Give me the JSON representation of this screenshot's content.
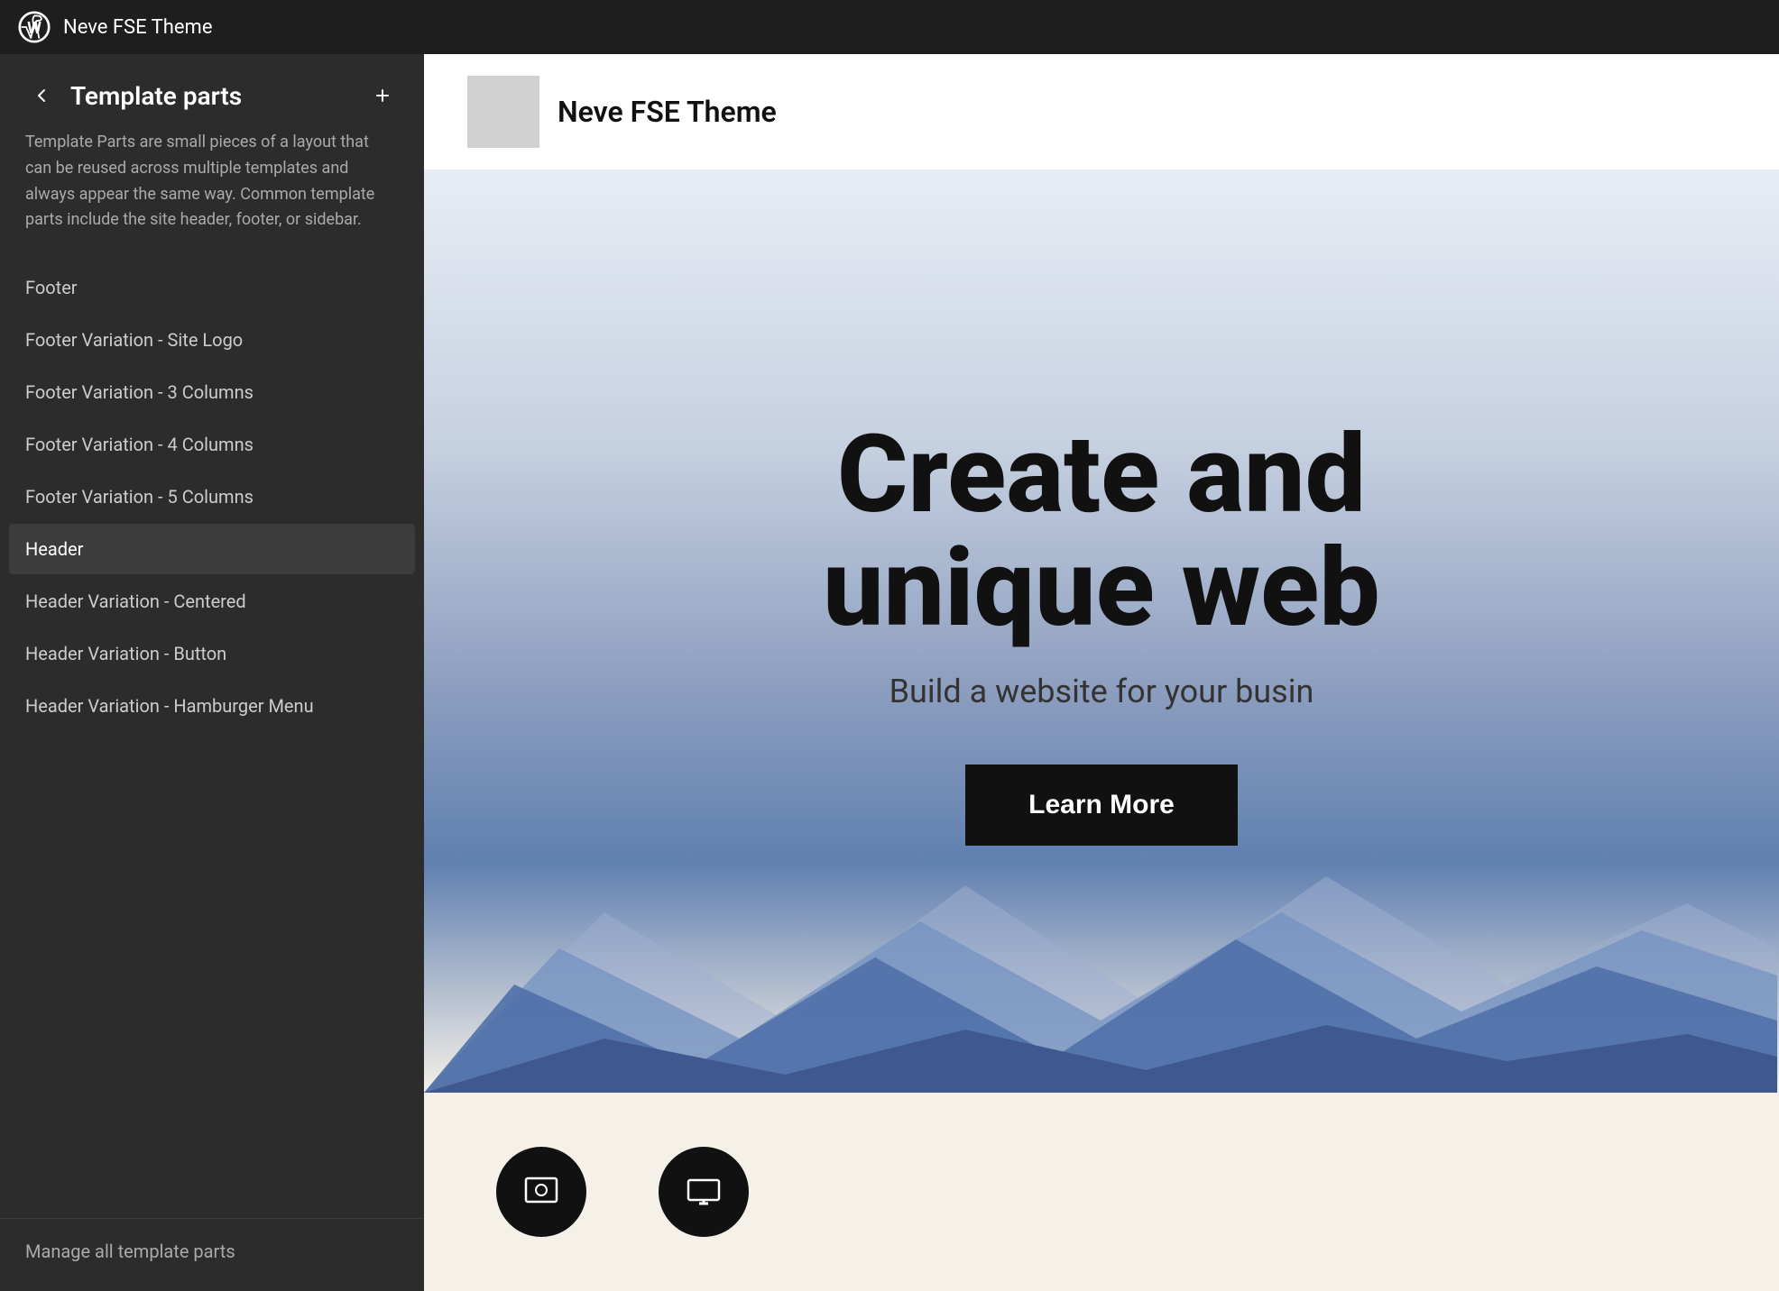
{
  "topbar": {
    "title": "Neve FSE Theme"
  },
  "sidebar": {
    "title": "Template parts",
    "description": "Template Parts are small pieces of a layout that can be reused across multiple templates and always appear the same way. Common template parts include the site header, footer, or sidebar.",
    "nav_items": [
      {
        "id": "footer",
        "label": "Footer",
        "active": false
      },
      {
        "id": "footer-site-logo",
        "label": "Footer Variation - Site Logo",
        "active": false
      },
      {
        "id": "footer-3-columns",
        "label": "Footer Variation - 3 Columns",
        "active": false
      },
      {
        "id": "footer-4-columns",
        "label": "Footer Variation - 4 Columns",
        "active": false
      },
      {
        "id": "footer-5-columns",
        "label": "Footer Variation - 5 Columns",
        "active": false
      },
      {
        "id": "header",
        "label": "Header",
        "active": true
      },
      {
        "id": "header-centered",
        "label": "Header Variation - Centered",
        "active": false
      },
      {
        "id": "header-button",
        "label": "Header Variation - Button",
        "active": false
      },
      {
        "id": "header-hamburger",
        "label": "Header Variation - Hamburger Menu",
        "active": false
      }
    ],
    "manage_link": "Manage all template parts",
    "back_button_label": "Back",
    "add_button_label": "Add"
  },
  "preview": {
    "site_name": "Neve FSE Theme",
    "hero_headline": "Create and",
    "hero_headline_2": "unique web",
    "hero_subtext": "Build a website for your busin",
    "learn_more_label": "Learn More",
    "icons": [
      "🖼",
      "💻"
    ]
  },
  "colors": {
    "sidebar_bg": "#2c2c2c",
    "topbar_bg": "#1e1e1e",
    "active_item_bg": "#3c3c3c",
    "hero_btn_bg": "#111111"
  }
}
